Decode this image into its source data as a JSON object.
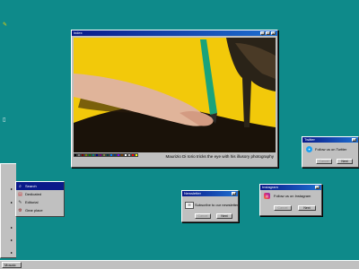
{
  "desktop": {
    "icons": [
      "desktop-icon-tl",
      "desktop-icon-ml"
    ]
  },
  "photo_window": {
    "title": "index",
    "caption": "Maurizio Di Iorio tricks the eye with his illusory photography",
    "palette": [
      "#000000",
      "#ffffff",
      "#808080",
      "#c0c0c0",
      "#800000",
      "#ff0000",
      "#808000",
      "#ffff00",
      "#008000",
      "#00ff00",
      "#008080",
      "#00ffff",
      "#000080",
      "#0000ff",
      "#800080",
      "#ff00ff",
      "#808040",
      "#ffff80",
      "#004040",
      "#00ff80",
      "#004080",
      "#0080ff",
      "#8000ff",
      "#ff0080",
      "#804000",
      "#ff8040"
    ]
  },
  "twitter_window": {
    "title": "Twitter",
    "message": "Follow us on Twitter",
    "cancel": "Cancel",
    "next": "Next"
  },
  "newsletter_window": {
    "title": "Newsletter",
    "message": "Subscribe to our newsletter",
    "cancel": "Cancel",
    "next": "Next"
  },
  "instagram_window": {
    "title": "Instagram",
    "message": "Follow us on Instagram",
    "cancel": "Cancel",
    "next": "Next"
  },
  "start_menu": {
    "items": [
      {
        "label": "Search",
        "icon": "search-icon",
        "selected": true
      },
      {
        "label": "Dedicated",
        "icon": "document-icon",
        "selected": false
      },
      {
        "label": "Editorial",
        "icon": "pencil-icon",
        "selected": false
      },
      {
        "label": "Gear place",
        "icon": "gear-icon",
        "selected": false
      }
    ]
  },
  "taskbar": {
    "start_label": "Mosaic"
  },
  "colors": {
    "desktop": "#0e8a8a",
    "title_start": "#0a1a8a",
    "title_end": "#1e6fd0",
    "photo_bg": "#f2c90a"
  }
}
